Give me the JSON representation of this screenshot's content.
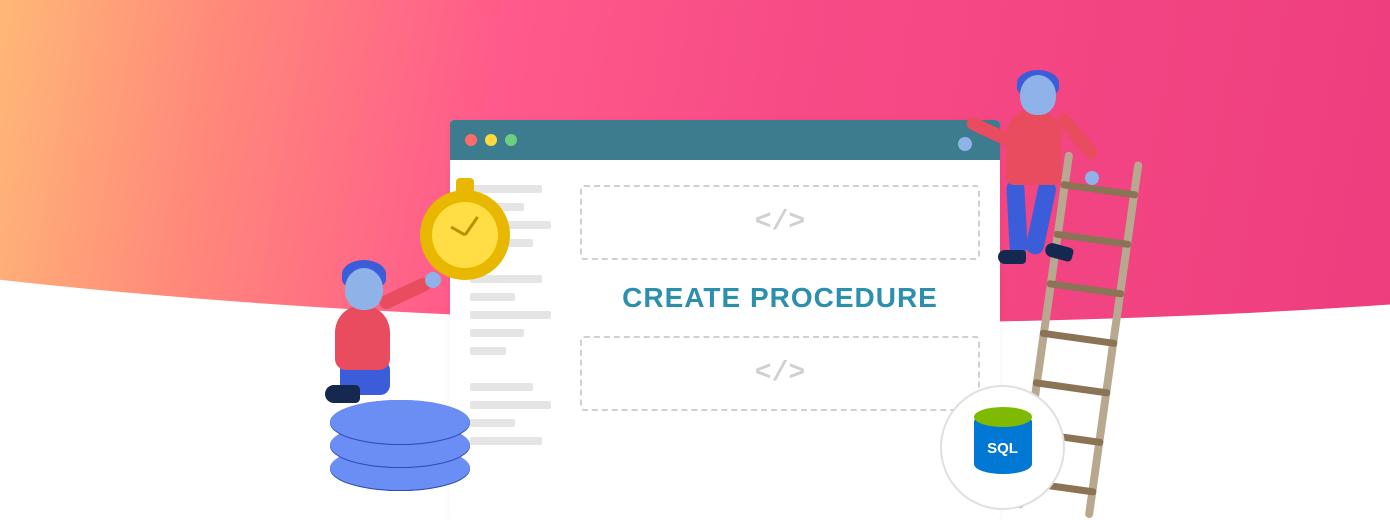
{
  "headline_text": "CREATE PROCEDURE",
  "code_symbol": "</>",
  "sql_badge_label": "SQL",
  "colors": {
    "gradient_start": "#ffb877",
    "gradient_end": "#ee3d7e",
    "window_bar": "#3d7b8f",
    "headline_color": "#2b8fad",
    "database_blue": "#3b5dd9",
    "person_shirt": "#e84c5e",
    "skin": "#8fb3e8",
    "clock_gold": "#ffdd44",
    "sql_blue": "#0078d4",
    "sql_green": "#7fba00"
  },
  "illustration": {
    "left_figure": "person-kneeling-holding-clock",
    "right_figure": "person-on-ladder",
    "stacked_object": "database-cylinders",
    "badge": "sql-server-logo"
  }
}
